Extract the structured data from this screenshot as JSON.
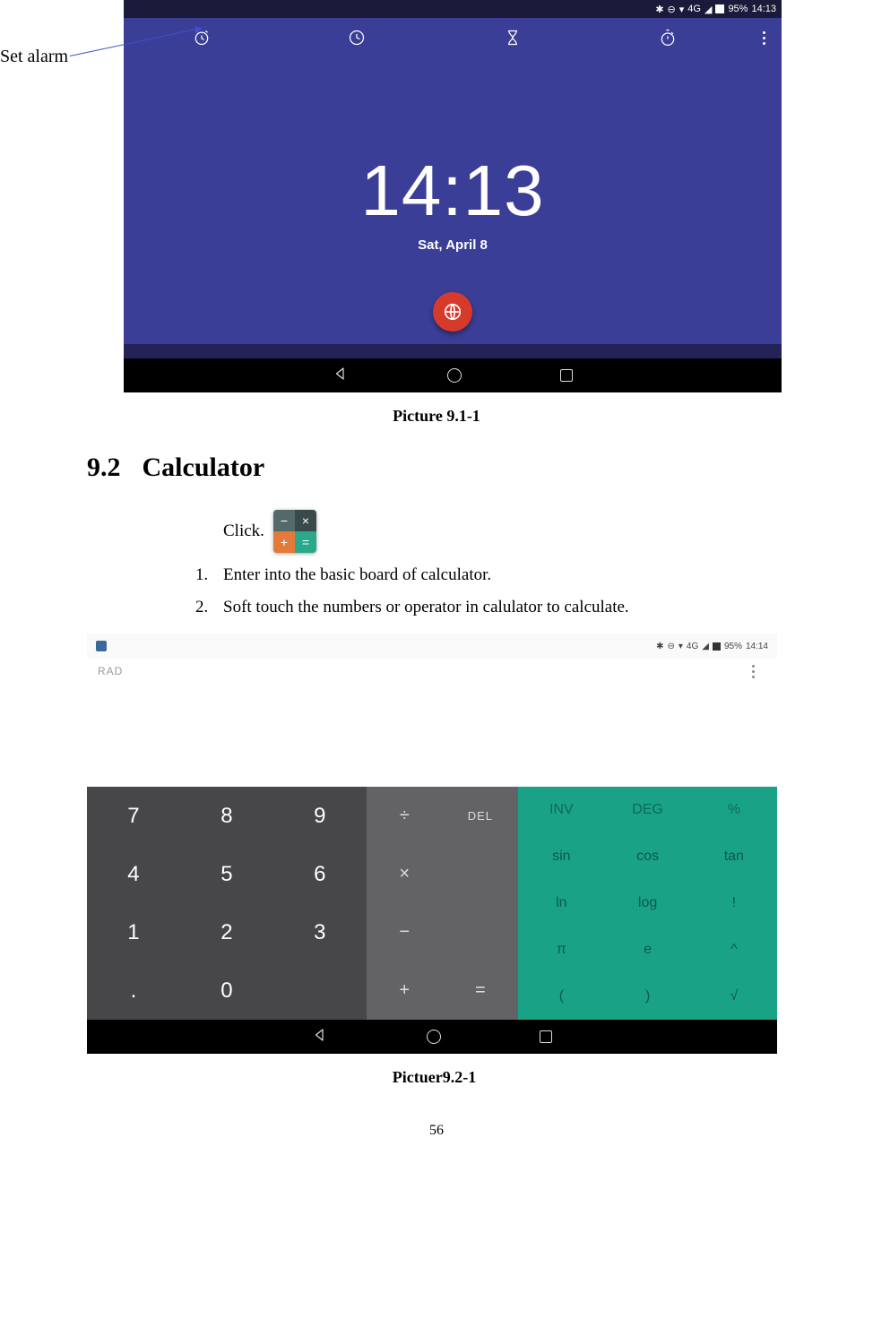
{
  "annotation": {
    "label": "Set alarm"
  },
  "screenshot1": {
    "status": {
      "signal": "4G",
      "battery": "95%",
      "time": "14:13"
    },
    "clock": {
      "time": "14:13",
      "date": "Sat, April 8"
    },
    "caption": "Picture 9.1-1"
  },
  "section": {
    "number": "9.2",
    "title": "Calculator"
  },
  "steps": {
    "s1": "Click.",
    "s2": "Enter into the basic board of calculator.",
    "s3": "Soft touch the numbers or operator in calulator to calculate."
  },
  "calc_icon": {
    "q1": "−",
    "q2": "×",
    "q3": "+",
    "q4": "="
  },
  "screenshot2": {
    "status": {
      "signal": "4G",
      "battery": "95%",
      "time": "14:14"
    },
    "mode": "RAD",
    "numpad": [
      "7",
      "8",
      "9",
      "4",
      "5",
      "6",
      "1",
      "2",
      "3",
      ".",
      "0",
      ""
    ],
    "ops": {
      "div": "÷",
      "del": "DEL",
      "mul": "×",
      "sub": "−",
      "add": "+",
      "eq": "="
    },
    "sci": {
      "inv": "INV",
      "deg": "DEG",
      "pct": "%",
      "sin": "sin",
      "cos": "cos",
      "tan": "tan",
      "ln": "ln",
      "log": "log",
      "fact": "!",
      "pi": "π",
      "e": "e",
      "pow": "^",
      "lp": "(",
      "rp": ")",
      "sqrt": "√"
    },
    "caption": "Pictuer9.2-1"
  },
  "page_number": "56"
}
